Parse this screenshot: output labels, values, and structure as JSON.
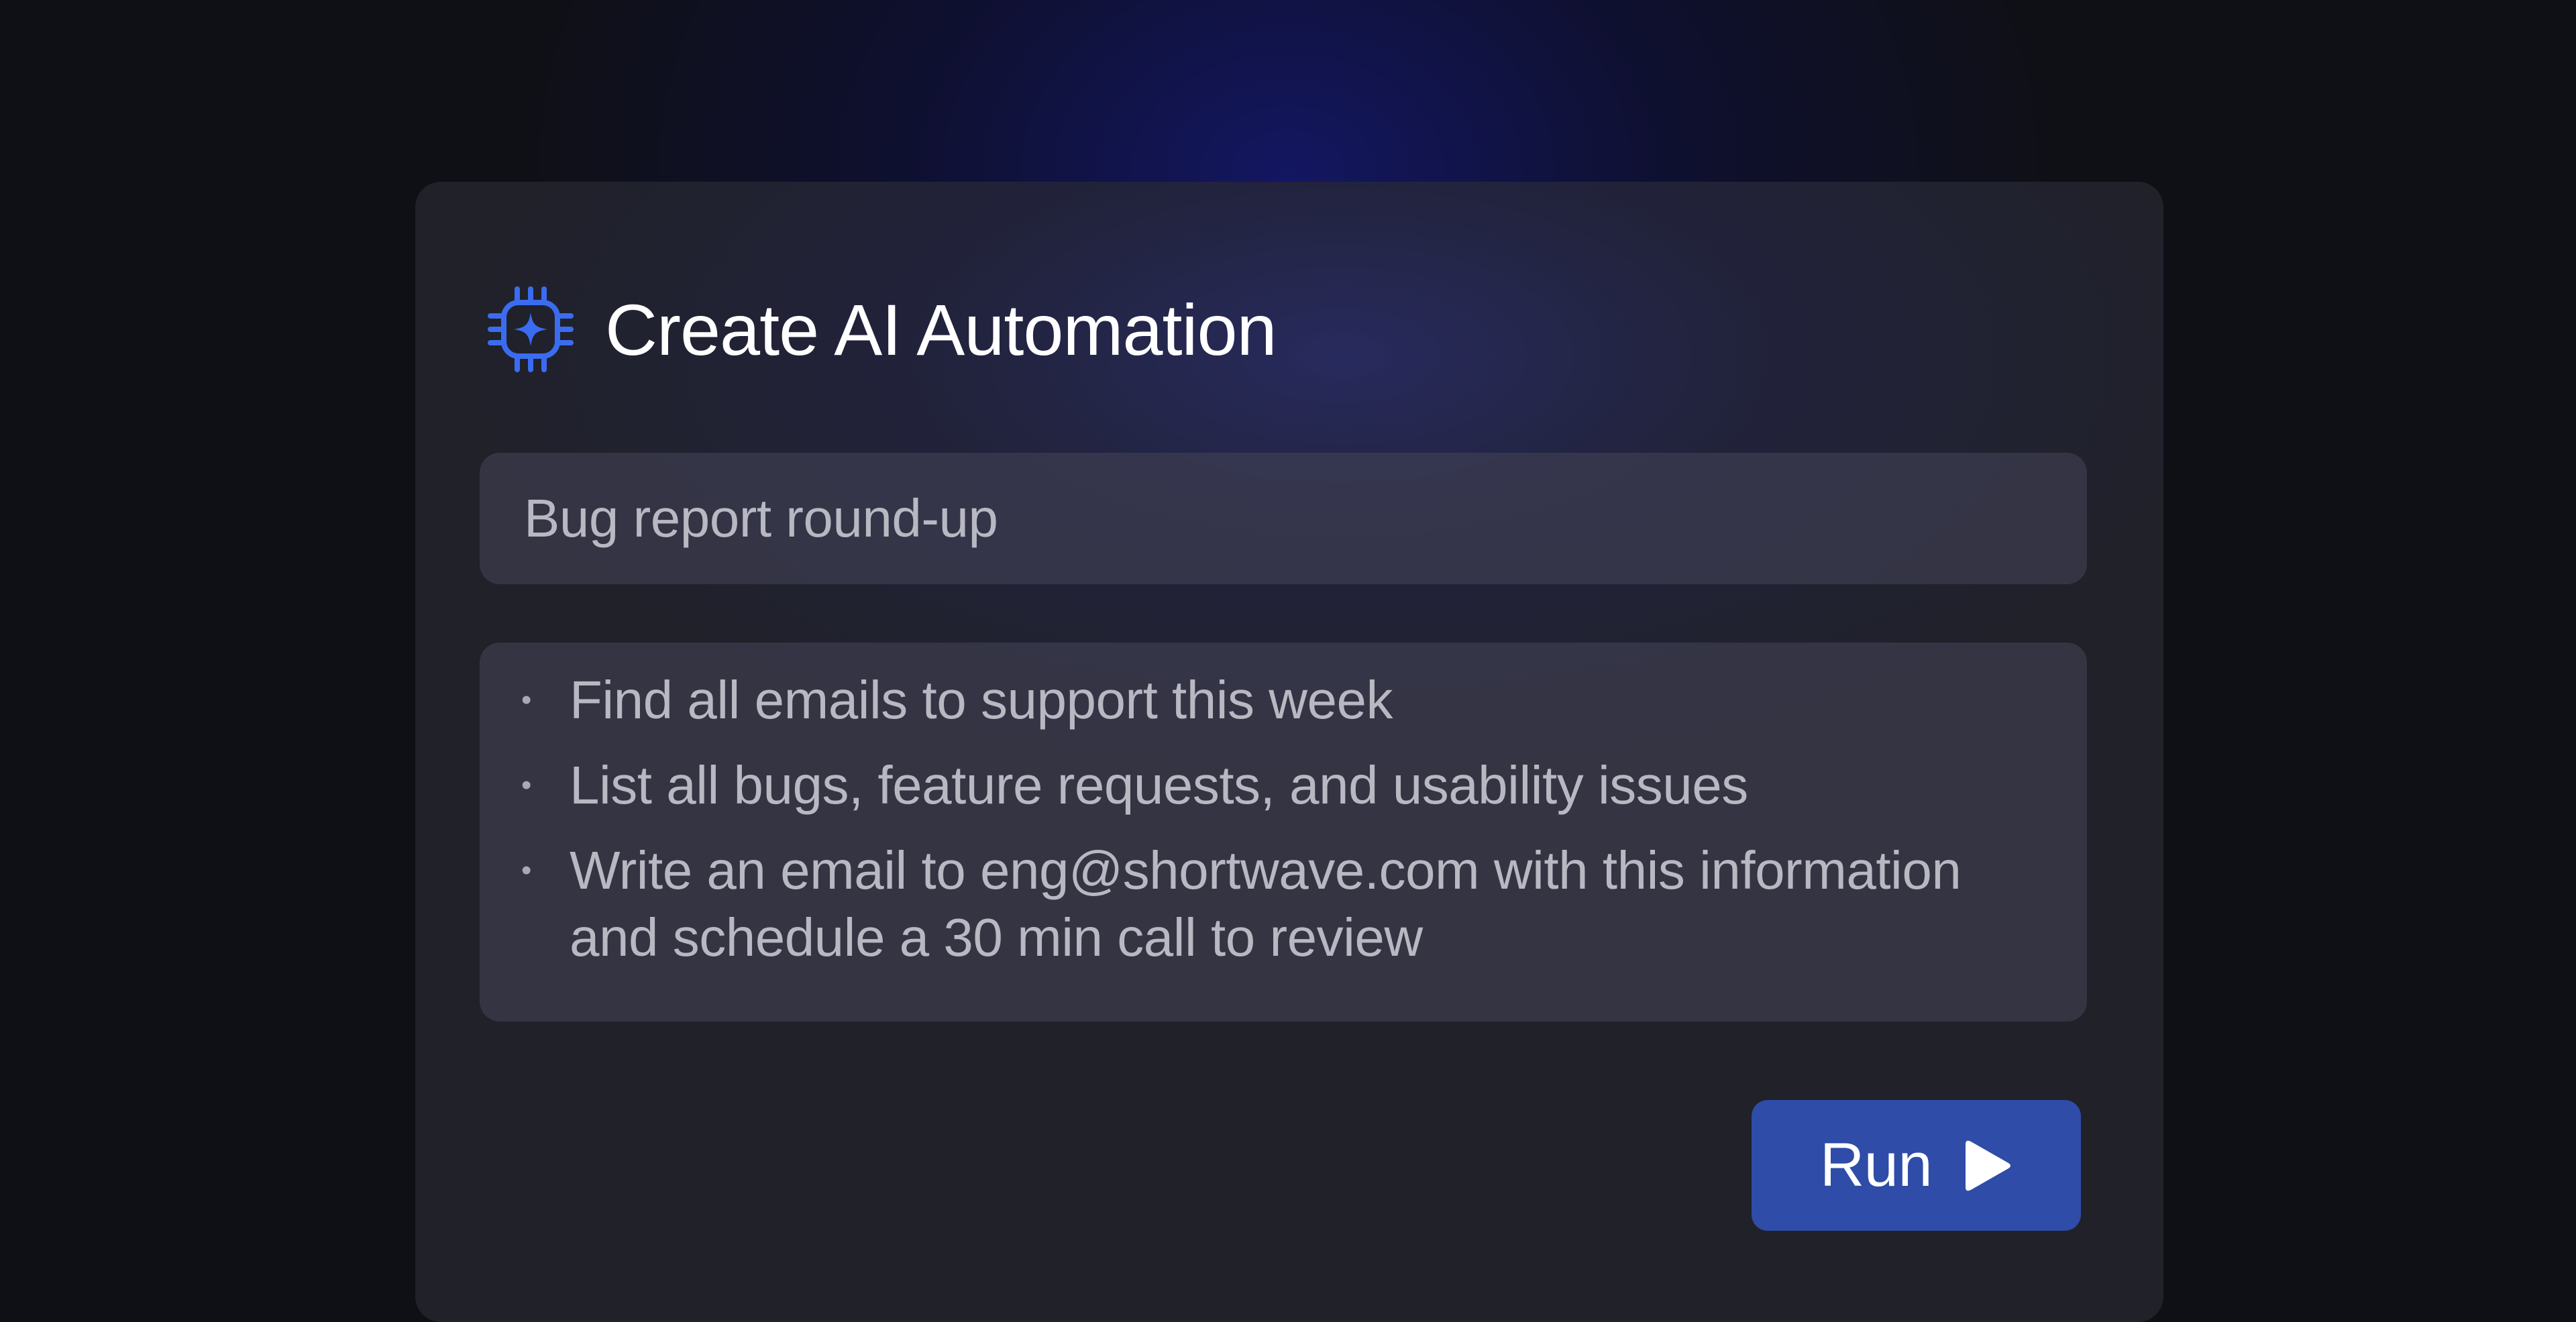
{
  "dialog": {
    "title": "Create AI Automation",
    "icon": "ai-chip-sparkle-icon",
    "accent_color": "#3b6cf0"
  },
  "automation_name": {
    "value": "Bug report round-up"
  },
  "prompt": {
    "items": [
      "Find all emails to support this week",
      "List all bugs, feature requests, and usability issues",
      "Write an email to eng@shortwave.com with this information and schedule a 30 min call to review"
    ]
  },
  "run_button": {
    "label": "Run",
    "icon": "play-icon",
    "color": "#2e4ca8"
  },
  "colors": {
    "background": "#0f1015",
    "card": "#202129",
    "field": "#35353f",
    "text_primary": "#ffffff",
    "text_secondary": "#b8b8c2"
  }
}
